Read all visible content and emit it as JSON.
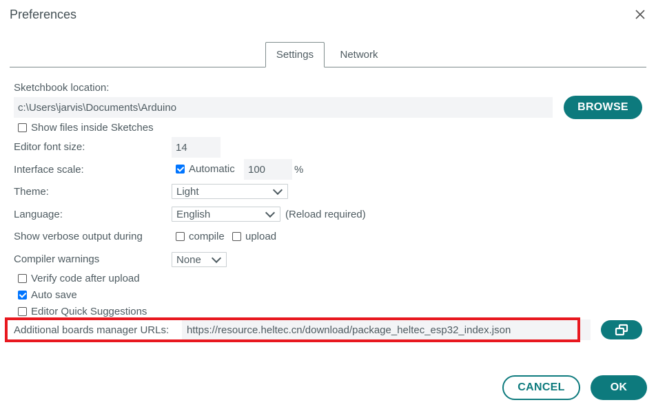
{
  "dialog": {
    "title": "Preferences"
  },
  "tabs": [
    {
      "label": "Settings"
    },
    {
      "label": "Network"
    }
  ],
  "sketchbook": {
    "label": "Sketchbook location:",
    "value": "c:\\Users\\jarvis\\Documents\\Arduino",
    "browse_label": "BROWSE"
  },
  "show_files": {
    "label": "Show files inside Sketches",
    "checked": false
  },
  "font_size": {
    "label": "Editor font size:",
    "value": "14"
  },
  "interface_scale": {
    "label": "Interface scale:",
    "automatic_label": "Automatic",
    "automatic_checked": true,
    "value": "100",
    "unit": "%"
  },
  "theme": {
    "label": "Theme:",
    "value": "Light"
  },
  "language": {
    "label": "Language:",
    "value": "English",
    "note": "(Reload required)"
  },
  "verbose": {
    "label": "Show verbose output during",
    "compile_label": "compile",
    "upload_label": "upload",
    "compile_checked": false,
    "upload_checked": false
  },
  "compiler_warnings": {
    "label": "Compiler warnings",
    "value": "None"
  },
  "verify": {
    "label": "Verify code after upload",
    "checked": false
  },
  "autosave": {
    "label": "Auto save",
    "checked": true
  },
  "quick_suggestions": {
    "label": "Editor Quick Suggestions",
    "checked": false
  },
  "boards_urls": {
    "label": "Additional boards manager URLs:",
    "value": "https://resource.heltec.cn/download/package_heltec_esp32_index.json"
  },
  "footer": {
    "cancel_label": "CANCEL",
    "ok_label": "OK"
  },
  "colors": {
    "accent": "#0d7a7d",
    "highlight": "#e8181f",
    "checkbox": "#0075ff"
  }
}
